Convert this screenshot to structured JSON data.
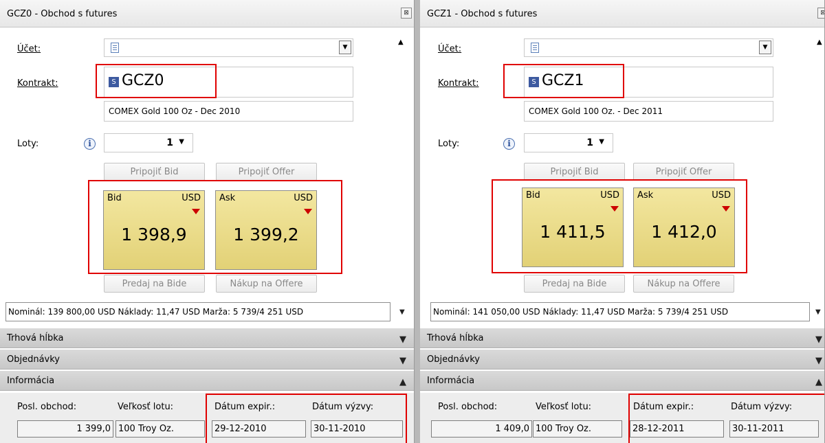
{
  "panels": [
    {
      "title": "GCZ0 - Obchod s futures",
      "close": "⊠",
      "ucet_label": "Účet:",
      "kontrakt_label": "Kontrakt:",
      "kontrakt_value": "GCZ0",
      "kontrakt_icon": "S",
      "description": "COMEX Gold 100 Oz - Dec 2010",
      "loty_label": "Loty:",
      "loty_value": "1",
      "info_icon": "i",
      "pripojit_bid": "Pripojiť Bid",
      "pripojit_offer": "Pripojiť Offer",
      "bid": {
        "label": "Bid",
        "currency": "USD",
        "value": "1 398,9"
      },
      "ask": {
        "label": "Ask",
        "currency": "USD",
        "value": "1 399,2"
      },
      "predaj": "Predaj na Bide",
      "nakup": "Nákup na Offere",
      "summary": "Nominál: 139 800,00 USD  Náklady: 11,47 USD  Marža: 5 739/4 251 USD",
      "sections": [
        "Trhová hĺbka",
        "Objednávky",
        "Informácia"
      ],
      "info": {
        "posl_obchod_label": "Posl. obchod:",
        "velkost_lotu_label": "Veľkosť lotu:",
        "datum_expir_label": "Dátum expir.:",
        "datum_vyzvy_label": "Dátum výzvy:",
        "posl_obchod": "1 399,0",
        "velkost_lotu": "100 Troy Oz.",
        "datum_expir": "29-12-2010",
        "datum_vyzvy": "30-11-2010"
      }
    },
    {
      "title": "GCZ1 - Obchod s futures",
      "close": "⊠",
      "ucet_label": "Účet:",
      "kontrakt_label": "Kontrakt:",
      "kontrakt_value": "GCZ1",
      "kontrakt_icon": "S",
      "description": "COMEX Gold 100 Oz. - Dec 2011",
      "loty_label": "Loty:",
      "loty_value": "1",
      "info_icon": "i",
      "pripojit_bid": "Pripojiť Bid",
      "pripojit_offer": "Pripojiť Offer",
      "bid": {
        "label": "Bid",
        "currency": "USD",
        "value": "1 411,5"
      },
      "ask": {
        "label": "Ask",
        "currency": "USD",
        "value": "1 412,0"
      },
      "predaj": "Predaj na Bide",
      "nakup": "Nákup na Offere",
      "summary": "Nominál: 141 050,00 USD  Náklady: 11,47 USD  Marža: 5 739/4 251 USD",
      "sections": [
        "Trhová hĺbka",
        "Objednávky",
        "Informácia"
      ],
      "info": {
        "posl_obchod_label": "Posl. obchod:",
        "velkost_lotu_label": "Veľkosť lotu:",
        "datum_expir_label": "Dátum expir.:",
        "datum_vyzvy_label": "Dátum výzvy:",
        "posl_obchod": "1 409,0",
        "velkost_lotu": "100 Troy Oz.",
        "datum_expir": "28-12-2011",
        "datum_vyzvy": "30-11-2011"
      }
    }
  ],
  "colors": {
    "highlight": "#e00000",
    "quote_bg": "#ecdc8a",
    "section_bg": "#d0d0d0"
  },
  "icons": [
    "close-icon",
    "dropdown-arrow-icon",
    "document-icon",
    "instrument-s-icon",
    "info-icon",
    "scroll-up-icon",
    "chevron-down-icon",
    "chevron-up-icon",
    "price-down-triangle-icon"
  ]
}
